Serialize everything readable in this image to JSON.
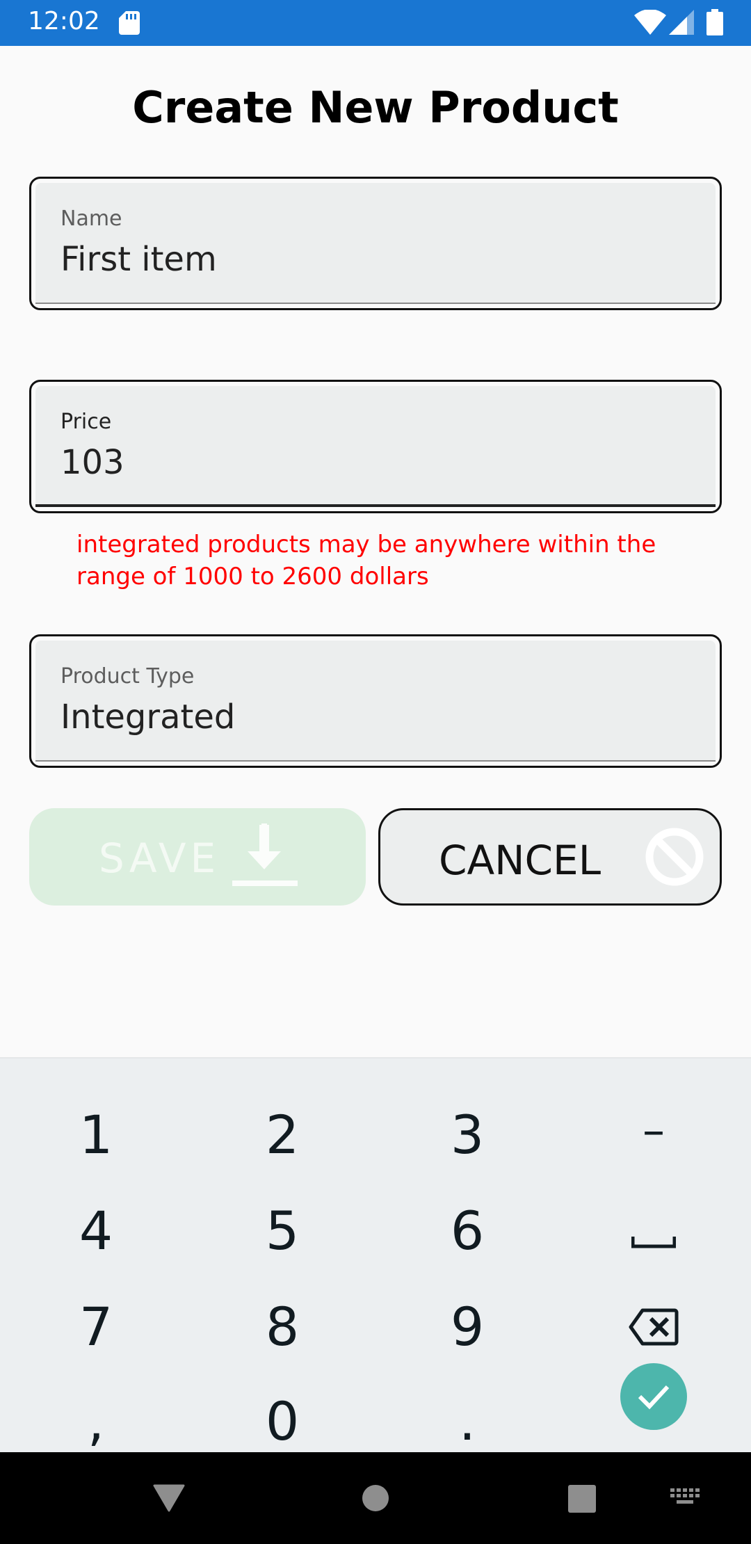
{
  "status_bar": {
    "time": "12:02",
    "icons": [
      "sd-card-icon",
      "wifi-icon",
      "cell-signal-icon",
      "battery-icon"
    ]
  },
  "page": {
    "title": "Create New Product"
  },
  "form": {
    "name": {
      "label": "Name",
      "value": "First item"
    },
    "price": {
      "label": "Price",
      "value": "103",
      "error": "integrated products may be anywhere within the range of 1000 to 2600 dollars"
    },
    "product_type": {
      "label": "Product Type",
      "value": "Integrated"
    }
  },
  "buttons": {
    "save_label": "SAVE",
    "save_icon": "download-icon",
    "save_enabled": false,
    "cancel_label": "CANCEL",
    "cancel_icon": "block-icon"
  },
  "keyboard": {
    "keys": [
      "1",
      "2",
      "3",
      "–",
      "4",
      "5",
      "6",
      "␣",
      "7",
      "8",
      "9",
      "backspace",
      ",",
      "0",
      ".",
      "enter"
    ],
    "enter_color": "#4db6ac"
  },
  "nav_bar": {
    "icons": [
      "back-icon",
      "home-icon",
      "recents-icon",
      "keyboard-switch-icon"
    ]
  },
  "colors": {
    "status_bar": "#1976d2",
    "error": "#ff0000",
    "save_disabled": "#dcefdf"
  }
}
